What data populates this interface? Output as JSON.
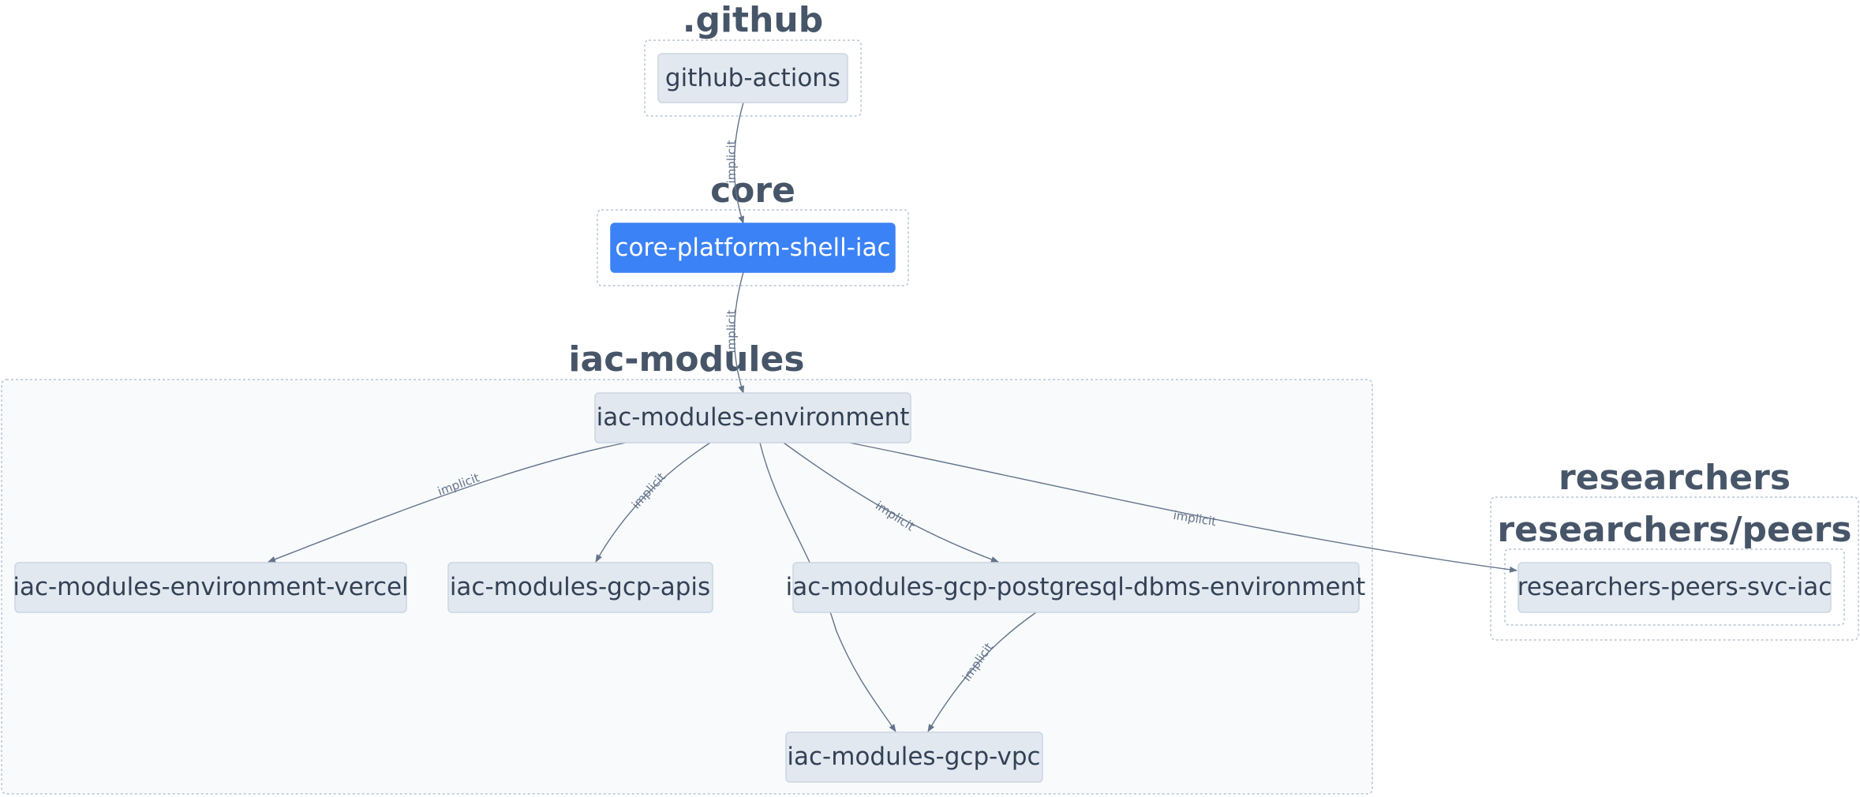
{
  "groups": [
    {
      "id": "github",
      "title": ".github"
    },
    {
      "id": "core",
      "title": "core"
    },
    {
      "id": "iac_modules",
      "title": "iac-modules"
    },
    {
      "id": "researchers",
      "title": "researchers"
    },
    {
      "id": "researchers_peers",
      "title": "researchers/peers"
    }
  ],
  "nodes": [
    {
      "id": "github_actions",
      "label": "github-actions",
      "highlight": false
    },
    {
      "id": "core_platform_shell_iac",
      "label": "core-platform-shell-iac",
      "highlight": true
    },
    {
      "id": "iac_modules_environment",
      "label": "iac-modules-environment",
      "highlight": false
    },
    {
      "id": "iac_modules_environment_vercel",
      "label": "iac-modules-environment-vercel",
      "highlight": false
    },
    {
      "id": "iac_modules_gcp_apis",
      "label": "iac-modules-gcp-apis",
      "highlight": false
    },
    {
      "id": "iac_modules_gcp_postgresql",
      "label": "iac-modules-gcp-postgresql-dbms-environment",
      "highlight": false
    },
    {
      "id": "iac_modules_gcp_vpc",
      "label": "iac-modules-gcp-vpc",
      "highlight": false
    },
    {
      "id": "researchers_peers_svc_iac",
      "label": "researchers-peers-svc-iac",
      "highlight": false
    }
  ],
  "edges": [
    {
      "from": "github_actions",
      "to": "core_platform_shell_iac",
      "label": "implicit"
    },
    {
      "from": "core_platform_shell_iac",
      "to": "iac_modules_environment",
      "label": "implicit"
    },
    {
      "from": "iac_modules_environment",
      "to": "iac_modules_environment_vercel",
      "label": "implicit"
    },
    {
      "from": "iac_modules_environment",
      "to": "iac_modules_gcp_apis",
      "label": "implicit"
    },
    {
      "from": "iac_modules_environment",
      "to": "iac_modules_gcp_vpc",
      "label": ""
    },
    {
      "from": "iac_modules_environment",
      "to": "iac_modules_gcp_postgresql",
      "label": "implicit"
    },
    {
      "from": "iac_modules_environment",
      "to": "researchers_peers_svc_iac",
      "label": "implicit"
    },
    {
      "from": "iac_modules_gcp_postgresql",
      "to": "iac_modules_gcp_vpc",
      "label": "implicit"
    }
  ],
  "colors": {
    "highlight_node": "#3b82f6",
    "node_fill": "#e2e8f0",
    "title_text": "#475569",
    "edge": "#64748b"
  }
}
